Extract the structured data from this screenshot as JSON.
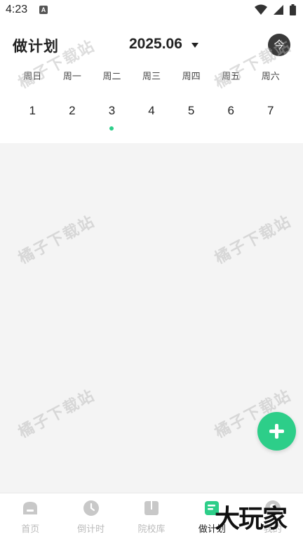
{
  "status_bar": {
    "time": "4:23",
    "notification_letter": "A"
  },
  "header": {
    "title": "做计划",
    "month": "2025.06",
    "today_label": "今"
  },
  "calendar": {
    "weekdays": [
      "周日",
      "周一",
      "周二",
      "周三",
      "周四",
      "周五",
      "周六"
    ],
    "days": [
      "1",
      "2",
      "3",
      "4",
      "5",
      "6",
      "7"
    ],
    "selected_day": "3"
  },
  "watermark_text": "橘子下载站",
  "tabbar": {
    "tabs": [
      {
        "label": "首页",
        "icon": "home-icon"
      },
      {
        "label": "倒计时",
        "icon": "clock-icon"
      },
      {
        "label": "院校库",
        "icon": "book-icon"
      },
      {
        "label": "做计划",
        "icon": "plan-icon"
      },
      {
        "label": "我的",
        "icon": "profile-icon"
      }
    ],
    "active": "做计划"
  },
  "brand_overlay": "大玩家",
  "colors": {
    "accent": "#2dce89",
    "inactive": "#bbbbbb",
    "background": "#f4f4f4"
  }
}
